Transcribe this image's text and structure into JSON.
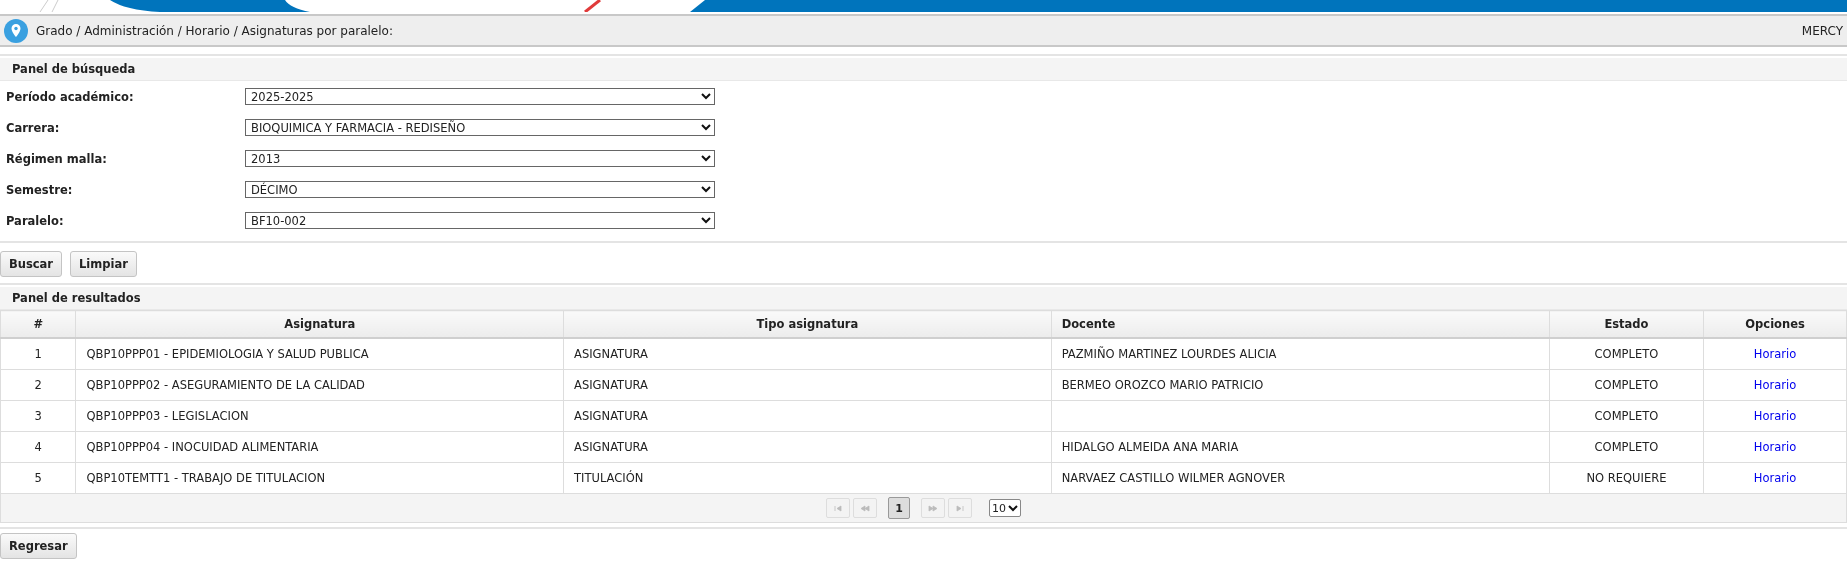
{
  "breadcrumb": "Grado / Administración / Horario / Asignaturas por paralelo:",
  "user": "MERCY",
  "search_panel": {
    "title": "Panel de búsqueda",
    "fields": [
      {
        "label": "Período académico:",
        "value": "2025-2025"
      },
      {
        "label": "Carrera:",
        "value": "BIOQUIMICA Y FARMACIA - REDISEÑO"
      },
      {
        "label": "Régimen malla:",
        "value": "2013"
      },
      {
        "label": "Semestre:",
        "value": "DÉCIMO"
      },
      {
        "label": "Paralelo:",
        "value": "BF10-002"
      }
    ]
  },
  "buttons": [
    "Buscar",
    "Limpiar"
  ],
  "results_panel": {
    "title": "Panel de resultados",
    "table": {
      "columns": [
        "#",
        "Asignatura",
        "Tipo asignatura",
        "Docente",
        "Estado",
        "Opciones"
      ],
      "rows": [
        {
          "n": "1",
          "asignatura": "QBP10PPP01 - EPIDEMIOLOGIA Y SALUD PUBLICA",
          "tipo": "ASIGNATURA",
          "docente": "PAZMIÑO MARTINEZ LOURDES ALICIA",
          "estado": "COMPLETO",
          "opcion": "Horario"
        },
        {
          "n": "2",
          "asignatura": "QBP10PPP02 - ASEGURAMIENTO DE LA CALIDAD",
          "tipo": "ASIGNATURA",
          "docente": "BERMEO OROZCO MARIO PATRICIO",
          "estado": "COMPLETO",
          "opcion": "Horario"
        },
        {
          "n": "3",
          "asignatura": "QBP10PPP03 - LEGISLACION",
          "tipo": "ASIGNATURA",
          "docente": "",
          "estado": "COMPLETO",
          "opcion": "Horario"
        },
        {
          "n": "4",
          "asignatura": "QBP10PPP04 - INOCUIDAD ALIMENTARIA",
          "tipo": "ASIGNATURA",
          "docente": "HIDALGO ALMEIDA ANA MARIA",
          "estado": "COMPLETO",
          "opcion": "Horario"
        },
        {
          "n": "5",
          "asignatura": "QBP10TEMTT1 - TRABAJO DE TITULACION",
          "tipo": "TITULACIÓN",
          "docente": "NARVAEZ CASTILLO WILMER AGNOVER",
          "estado": "NO REQUIERE",
          "opcion": "Horario"
        }
      ]
    },
    "paginator": {
      "pages": [
        {
          "label": "1",
          "selected": true
        }
      ],
      "page_size": "10"
    }
  },
  "back_button": "Regresar"
}
